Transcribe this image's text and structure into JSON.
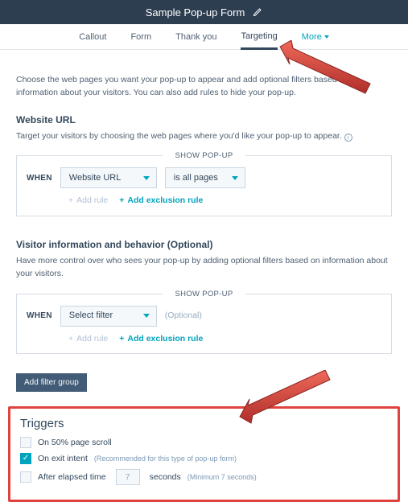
{
  "header": {
    "title": "Sample Pop-up Form"
  },
  "tabs": {
    "callout": "Callout",
    "form": "Form",
    "thankyou": "Thank you",
    "targeting": "Targeting",
    "more": "More"
  },
  "intro": "Choose the web pages you want your pop-up to appear and add optional filters based on information about your visitors. You can also add rules to hide your pop-up.",
  "section1": {
    "title": "Website URL",
    "desc": "Target your visitors by choosing the web pages where you'd like your pop-up to appear.",
    "legend": "SHOW POP-UP",
    "when": "WHEN",
    "select1": "Website URL",
    "select2": "is all pages",
    "add_rule": "Add rule",
    "add_exclusion": "Add exclusion rule"
  },
  "section2": {
    "title": "Visitor information and behavior (Optional)",
    "desc": "Have more control over who sees your pop-up by adding optional filters based on information about your visitors.",
    "legend": "SHOW POP-UP",
    "when": "WHEN",
    "select": "Select filter",
    "optional": "(Optional)",
    "add_rule": "Add rule",
    "add_exclusion": "Add exclusion rule"
  },
  "add_filter_btn": "Add filter group",
  "triggers": {
    "title": "Triggers",
    "opt1": "On 50% page scroll",
    "opt2": "On exit intent",
    "opt2_note": "(Recommended for this type of pop-up form)",
    "opt3_pre": "After elapsed time",
    "opt3_value": "7",
    "opt3_post": "seconds",
    "opt3_note": "(Minimum 7 seconds)"
  }
}
